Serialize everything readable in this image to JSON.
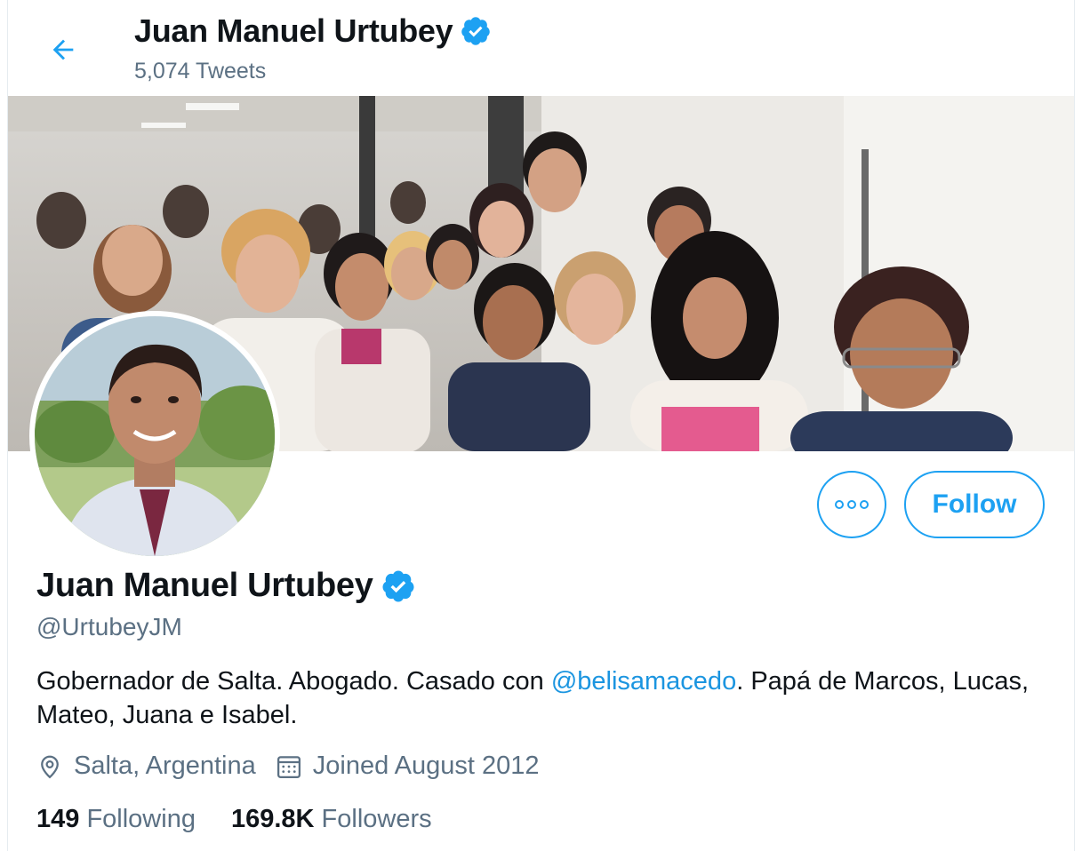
{
  "header": {
    "title": "Juan Manuel Urtubey",
    "tweet_count": "5,074 Tweets"
  },
  "profile": {
    "name": "Juan Manuel Urtubey",
    "handle": "@UrtubeyJM",
    "bio_part1": "Gobernador de Salta. Abogado. Casado con ",
    "bio_mention": "@belisamacedo",
    "bio_part2": ". Papá de Marcos, Lucas, Mateo, Juana e Isabel.",
    "location": "Salta, Argentina",
    "joined": "Joined August 2012",
    "following_count": "149",
    "following_label": "Following",
    "followers_count": "169.8K",
    "followers_label": "Followers"
  },
  "actions": {
    "follow_label": "Follow"
  },
  "icons": {
    "back": "arrow-left-icon",
    "verified": "verified-badge-icon",
    "more": "more-options-icon",
    "location": "location-pin-icon",
    "calendar": "calendar-icon"
  },
  "colors": {
    "accent": "#1da1f2",
    "link": "#1b95e0",
    "secondary_text": "#5b7083",
    "primary_text": "#0f1419"
  }
}
